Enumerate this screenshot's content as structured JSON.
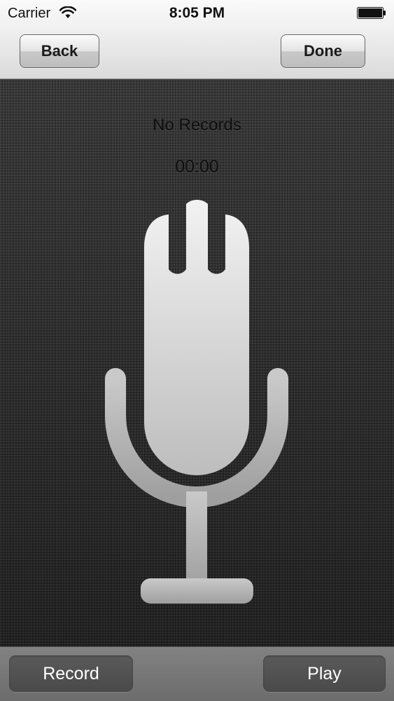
{
  "status_bar": {
    "carrier": "Carrier",
    "time": "8:05 PM",
    "wifi_icon": "wifi-icon",
    "battery_icon": "battery-icon"
  },
  "nav": {
    "back_label": "Back",
    "done_label": "Done"
  },
  "recorder": {
    "status_text": "No Records",
    "timer": "00:00",
    "icon": "microphone-icon"
  },
  "toolbar": {
    "record_label": "Record",
    "play_label": "Play"
  },
  "colors": {
    "nav_background": "#ececec",
    "main_background": "#2c2c2c",
    "microphone": "#d8d8d8",
    "toolbar_background": "#767676",
    "toolbar_button": "#525252"
  }
}
